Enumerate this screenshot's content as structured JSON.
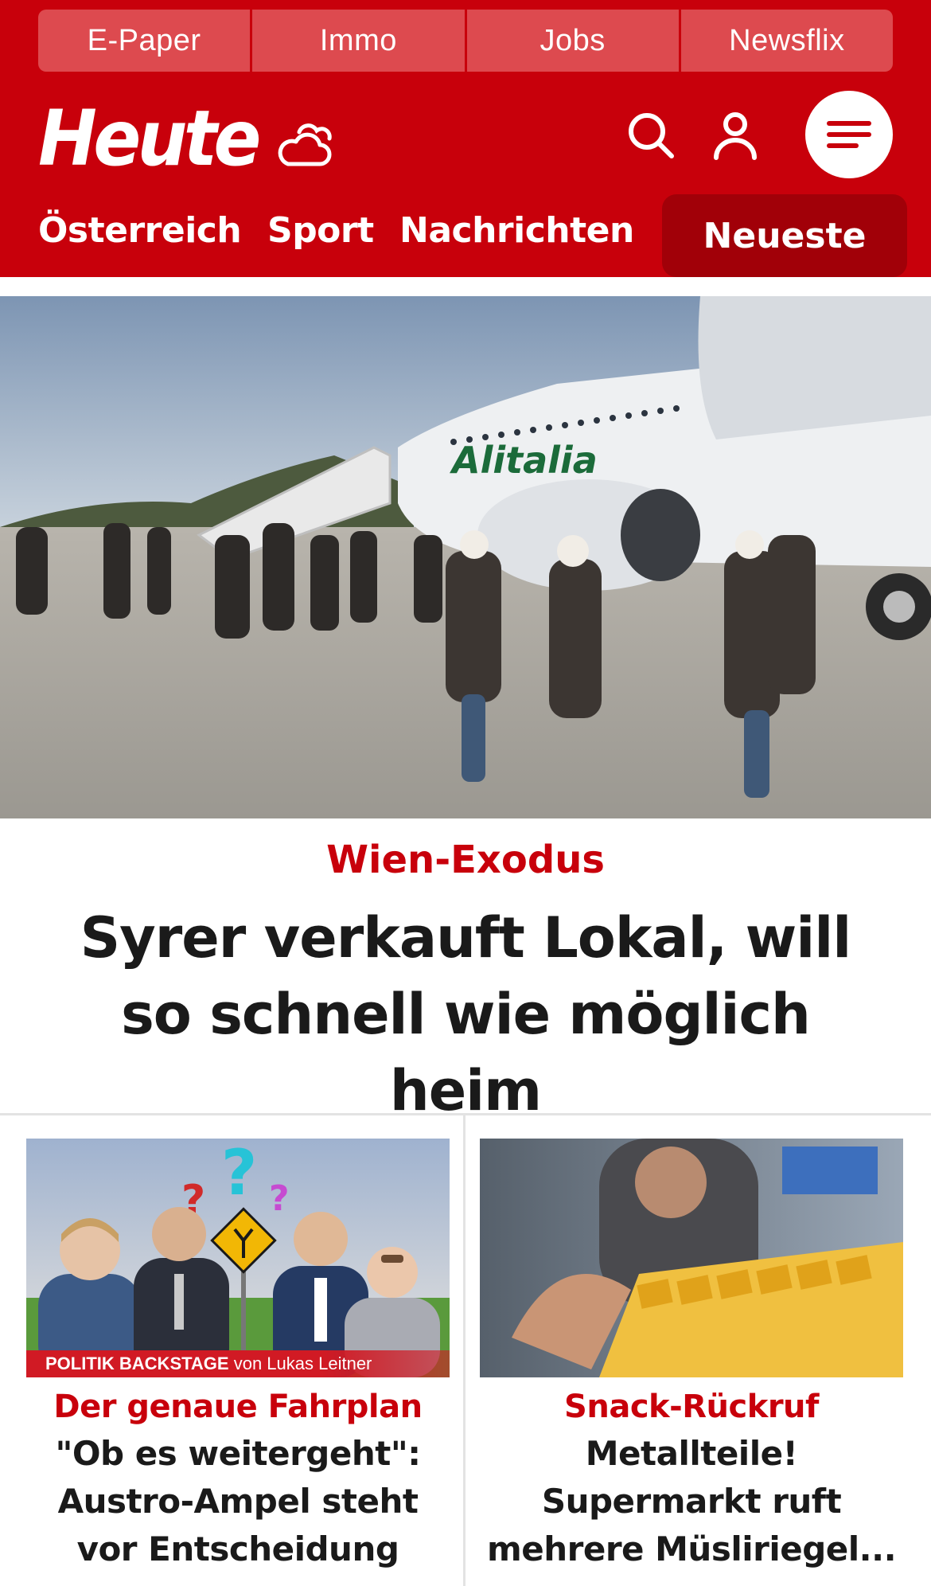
{
  "header": {
    "top_links": [
      "E-Paper",
      "Immo",
      "Jobs",
      "Newsflix"
    ],
    "logo_text": "Heute",
    "nav": {
      "oesterreich": "Österreich",
      "sport": "Sport",
      "nachrichten": "Nachrichten",
      "neueste": "Neueste"
    },
    "icons": {
      "weather": "cloud-sun-icon",
      "search": "search-icon",
      "account": "user-icon",
      "menu": "menu-icon"
    }
  },
  "hero": {
    "kicker": "Wien-Exodus",
    "title": "Syrer verkauft Lokal, will so schnell wie möglich heim",
    "image_text": "Alitalia"
  },
  "teasers": [
    {
      "image_label_strong": "POLITIK BACKSTAGE",
      "image_label_rest": " von Lukas Leitner",
      "kicker": "Der genaue Fahrplan",
      "title": "\"Ob es weitergeht\": Austro-Ampel steht vor Entscheidung"
    },
    {
      "kicker": "Snack-Rückruf",
      "title_line1": "Metallteile!",
      "title_line2": "Supermarkt ruft",
      "title_line3": "mehrere Müsliriegel..."
    }
  ],
  "colors": {
    "brand_red": "#c8000b",
    "top_link_bg": "#dd4a4f",
    "active_tab_bg": "#a10008",
    "text": "#1a1a1a"
  }
}
